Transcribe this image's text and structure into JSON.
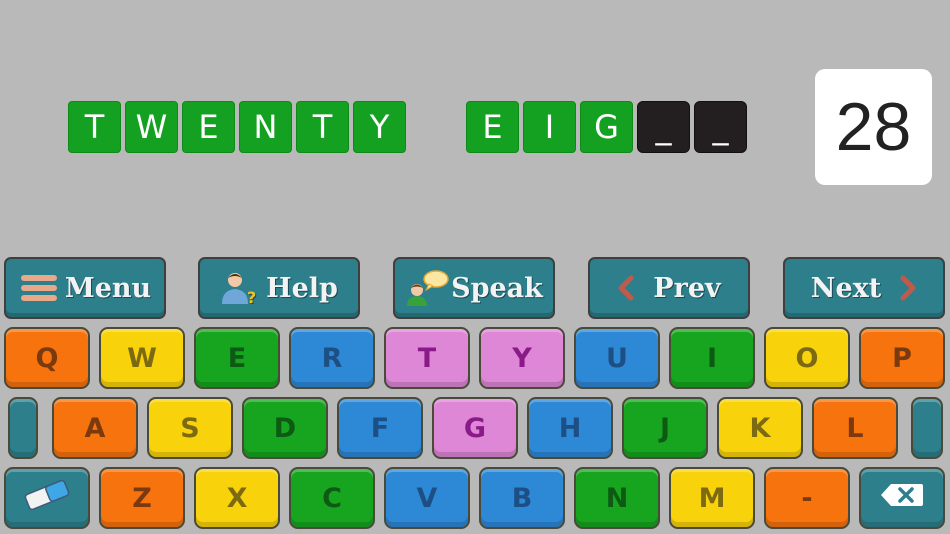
{
  "word": {
    "parts": [
      {
        "letters": [
          "T",
          "W",
          "E",
          "N",
          "T",
          "Y"
        ]
      },
      {
        "letters": [
          "E",
          "I",
          "G",
          "_",
          "_"
        ]
      }
    ]
  },
  "number": "28",
  "toolbar": {
    "menu_label": "Menu",
    "help_label": "Help",
    "speak_label": "Speak",
    "prev_label": "Prev",
    "next_label": "Next"
  },
  "keyboard": {
    "row1": [
      "Q",
      "W",
      "E",
      "R",
      "T",
      "Y",
      "U",
      "I",
      "O",
      "P"
    ],
    "row2": [
      "A",
      "S",
      "D",
      "F",
      "G",
      "H",
      "J",
      "K",
      "L"
    ],
    "row3": [
      "Z",
      "X",
      "C",
      "V",
      "B",
      "N",
      "M",
      "-"
    ]
  },
  "colors": {
    "orange": "#f6730e",
    "yellow": "#f8d20b",
    "green": "#17a51f",
    "blue": "#2d88d6",
    "pink": "#dd87d6",
    "teal": "#2d7f8c",
    "tile_green": "#14a020",
    "tile_blank": "#231f20",
    "background": "#b9b9b9"
  }
}
